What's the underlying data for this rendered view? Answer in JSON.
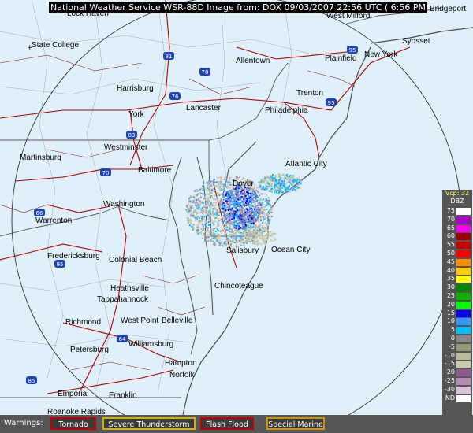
{
  "header": {
    "title": "National Weather Service WSR-88D Image from: DOX 09/03/2007 22:56 UTC ( 6:56 PM EDT)"
  },
  "map": {
    "labels": [
      {
        "id": "state-college",
        "text": "State College"
      },
      {
        "id": "allentown",
        "text": "Allentown"
      },
      {
        "id": "plainfield",
        "text": "Plainfield"
      },
      {
        "id": "new-york",
        "text": "New York"
      },
      {
        "id": "syosset",
        "text": "Syosset"
      },
      {
        "id": "west-milford",
        "text": "West Milford"
      },
      {
        "id": "bridgeport",
        "text": "Bridgeport"
      },
      {
        "id": "lock-haven",
        "text": "Lock Haven"
      },
      {
        "id": "harrisburg",
        "text": "Harrisburg"
      },
      {
        "id": "lancaster",
        "text": "Lancaster"
      },
      {
        "id": "trenton",
        "text": "Trenton"
      },
      {
        "id": "philadelphia",
        "text": "Philadelphia"
      },
      {
        "id": "york",
        "text": "York"
      },
      {
        "id": "westminster",
        "text": "Westminster"
      },
      {
        "id": "martinsburg",
        "text": "Martinsburg"
      },
      {
        "id": "baltimore",
        "text": "Baltimore"
      },
      {
        "id": "atlantic-city",
        "text": "Atlantic City"
      },
      {
        "id": "dover",
        "text": "Dover"
      },
      {
        "id": "washington",
        "text": "Washington"
      },
      {
        "id": "warrenton",
        "text": "Warrenton"
      },
      {
        "id": "salisbury",
        "text": "Salisbury"
      },
      {
        "id": "ocean-city",
        "text": "Ocean City"
      },
      {
        "id": "fredericksburg",
        "text": "Fredericksburg"
      },
      {
        "id": "colonial-beach",
        "text": "Colonial Beach"
      },
      {
        "id": "chincoteague",
        "text": "Chincoteague"
      },
      {
        "id": "heathsville",
        "text": "Heathsville"
      },
      {
        "id": "tappahannock",
        "text": "Tappahannock"
      },
      {
        "id": "richmond",
        "text": "Richmond"
      },
      {
        "id": "west-point",
        "text": "West Point"
      },
      {
        "id": "belle-haven",
        "text": "Belleville"
      },
      {
        "id": "williamsburg",
        "text": "Williamsburg"
      },
      {
        "id": "petersburg",
        "text": "Petersburg"
      },
      {
        "id": "hampton",
        "text": "Hampton"
      },
      {
        "id": "norfolk",
        "text": "Norfolk"
      },
      {
        "id": "emporia",
        "text": "Emporia"
      },
      {
        "id": "franklin",
        "text": "Franklin"
      },
      {
        "id": "roanoke-rapids",
        "text": "Roanoke Rapids"
      }
    ],
    "highways": [
      {
        "id": "i-81",
        "text": "81"
      },
      {
        "id": "i-78",
        "text": "78"
      },
      {
        "id": "i-76",
        "text": "76"
      },
      {
        "id": "i-83",
        "text": "83"
      },
      {
        "id": "i-95-nj",
        "text": "95"
      },
      {
        "id": "i-95-ny",
        "text": "95"
      },
      {
        "id": "i-70",
        "text": "70"
      },
      {
        "id": "i-66",
        "text": "66"
      },
      {
        "id": "i-95-va",
        "text": "95"
      },
      {
        "id": "i-64",
        "text": "64"
      },
      {
        "id": "i-85",
        "text": "85"
      }
    ]
  },
  "legend": {
    "vcp": "Vcp: 32",
    "unit": "DBZ",
    "rows": [
      {
        "label": "75",
        "color": "#ffffff"
      },
      {
        "label": "70",
        "color": "#aa00cc"
      },
      {
        "label": "65",
        "color": "#ff00ff"
      },
      {
        "label": "60",
        "color": "#a00000"
      },
      {
        "label": "55",
        "color": "#c80000"
      },
      {
        "label": "50",
        "color": "#ff0000"
      },
      {
        "label": "45",
        "color": "#ff8c00"
      },
      {
        "label": "40",
        "color": "#ffcc00"
      },
      {
        "label": "35",
        "color": "#ffff00"
      },
      {
        "label": "30",
        "color": "#008800"
      },
      {
        "label": "25",
        "color": "#00b400"
      },
      {
        "label": "20",
        "color": "#00ff00"
      },
      {
        "label": "15",
        "color": "#0000ff"
      },
      {
        "label": "10",
        "color": "#3399ff"
      },
      {
        "label": "5",
        "color": "#00bfff"
      },
      {
        "label": "0",
        "color": "#888888"
      },
      {
        "label": "-5",
        "color": "#999977"
      },
      {
        "label": "-10",
        "color": "#bbbb99"
      },
      {
        "label": "-15",
        "color": "#ccccaa"
      },
      {
        "label": "-20",
        "color": "#8e5b8e"
      },
      {
        "label": "-25",
        "color": "#b48bb4"
      },
      {
        "label": "-30",
        "color": "#d8c3d8"
      },
      {
        "label": "ND",
        "color": "#ffffff"
      }
    ]
  },
  "warnings": {
    "label": "Warnings:",
    "items": [
      {
        "id": "tornado",
        "text": "Tornado",
        "border": "#c00000"
      },
      {
        "id": "severe-thunderstorm",
        "text": "Severe Thunderstorm",
        "border": "#d4b000"
      },
      {
        "id": "flash-flood",
        "text": "Flash Flood",
        "border": "#c00000"
      },
      {
        "id": "special-marine",
        "text": "Special Marine",
        "border": "#d49000"
      }
    ]
  }
}
